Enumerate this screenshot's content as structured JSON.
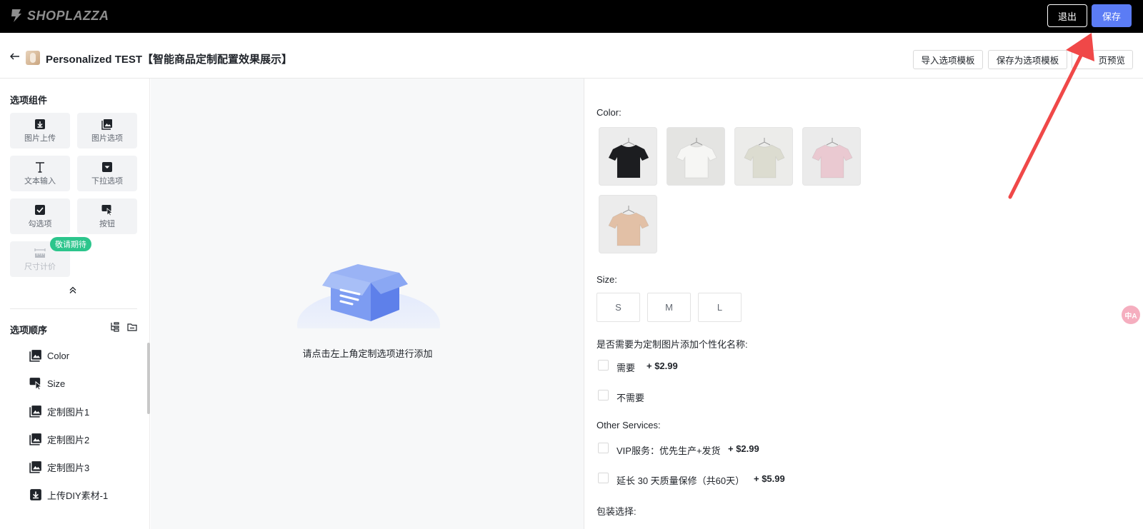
{
  "topbar": {
    "logo_text": "SHOPLAZZA",
    "exit_label": "退出",
    "save_label": "保存"
  },
  "header": {
    "title": "Personalized TEST【智能商品定制配置效果展示】",
    "import_template_label": "导入选项模板",
    "save_as_template_label": "保存为选项模板",
    "preview_label": "页预览"
  },
  "left": {
    "components_title": "选项组件",
    "components": [
      {
        "label": "图片上传",
        "icon": "download-box-icon"
      },
      {
        "label": "图片选项",
        "icon": "image-stack-icon"
      },
      {
        "label": "文本输入",
        "icon": "text-T-icon"
      },
      {
        "label": "下拉选项",
        "icon": "dropdown-box-icon"
      },
      {
        "label": "勾选项",
        "icon": "checkbox-icon"
      },
      {
        "label": "按钮",
        "icon": "cursor-button-icon"
      },
      {
        "label": "尺寸计价",
        "icon": "ruler-icon"
      }
    ],
    "coming_badge": "敬请期待",
    "order_title": "选项顺序",
    "order_items": [
      {
        "label": "Color",
        "icon": "image-stack-icon"
      },
      {
        "label": "Size",
        "icon": "cursor-button-icon"
      },
      {
        "label": "定制图片1",
        "icon": "image-stack-icon"
      },
      {
        "label": "定制图片2",
        "icon": "image-stack-icon"
      },
      {
        "label": "定制图片3",
        "icon": "image-stack-icon"
      },
      {
        "label": "上传DIY素材-1",
        "icon": "download-box-icon"
      }
    ]
  },
  "canvas": {
    "empty_text": "请点击左上角定制选项进行添加"
  },
  "preview": {
    "color_label": "Color:",
    "colors": [
      {
        "shirt": "#1c1d20",
        "bg": "#ececec"
      },
      {
        "shirt": "#f6f6f4",
        "bg": "#e4e4e2"
      },
      {
        "shirt": "#dcdcd0",
        "bg": "#ececea"
      },
      {
        "shirt": "#eac9d1",
        "bg": "#ebebeb"
      },
      {
        "shirt": "#e2c0a6",
        "bg": "#ececec"
      }
    ],
    "size_label": "Size:",
    "sizes": [
      "S",
      "M",
      "L"
    ],
    "name_question": "是否需要为定制图片添加个性化名称:",
    "name_options": [
      {
        "label": "需要",
        "price": "+ $2.99"
      },
      {
        "label": "不需要",
        "price": ""
      }
    ],
    "services_label": "Other Services:",
    "services": [
      {
        "label": "VIP服务：优先生产+发货",
        "price": "+ $2.99"
      },
      {
        "label": "延长 30 天质量保修（共60天）",
        "price": "+ $5.99"
      }
    ],
    "packaging_label": "包装选择:"
  },
  "translate_fab": "中A",
  "colors": {
    "topbar_bg": "#000000",
    "save_blue": "#5b7cf5",
    "badge_green": "#2cc58c",
    "arrow_red": "#f04848"
  }
}
